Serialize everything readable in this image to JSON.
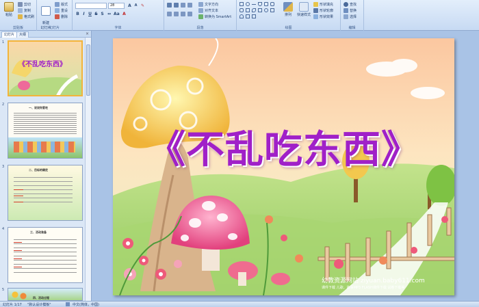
{
  "ribbon": {
    "clipboard": {
      "group_label": "剪贴板",
      "paste_label": "粘贴",
      "cut_label": "剪切",
      "copy_label": "复制",
      "format_painter_label": "格式刷"
    },
    "slides": {
      "group_label": "幻灯片",
      "new_slide_label": "新建\n幻灯片",
      "layout_label": "版式",
      "reset_label": "重设",
      "delete_label": "删除"
    },
    "font": {
      "group_label": "字体",
      "font_size": "28"
    },
    "paragraph": {
      "group_label": "段落",
      "text_direction_label": "文字方向",
      "align_text_label": "对齐文本",
      "smartart_label": "转换为 SmartArt"
    },
    "drawing": {
      "group_label": "绘图",
      "arrange_label": "排列",
      "quick_styles_label": "快速样式",
      "shape_fill_label": "形状填充",
      "shape_outline_label": "形状轮廓",
      "shape_effects_label": "形状效果"
    },
    "editing": {
      "group_label": "编辑",
      "find_label": "查找",
      "replace_label": "替换",
      "select_label": "选择"
    }
  },
  "left_panel": {
    "tab_slides": "幻灯片",
    "tab_outline": "大纲",
    "close_glyph": "×",
    "thumbnails": [
      {
        "number": "1",
        "title": "《不乱吃东西》"
      },
      {
        "number": "2",
        "title": "一、说说你爱吃"
      },
      {
        "number": "3",
        "title": "二、目标的确定"
      },
      {
        "number": "4",
        "title": "三、活动准备"
      },
      {
        "number": "5",
        "title": "四、活动过程"
      }
    ]
  },
  "slide": {
    "title": "《不乱吃东西》",
    "watermark_main": "幼教资源网站  ziyuan.baby611.com",
    "watermark_sub": "课件下载  儿歌、故事MP3  FLASH课件下载  试卷下载等"
  },
  "statusbar": {
    "slide_counter": "幻灯片 1/17",
    "theme": "\"默认设计模板\"",
    "language": "中文(简体，中国)"
  }
}
